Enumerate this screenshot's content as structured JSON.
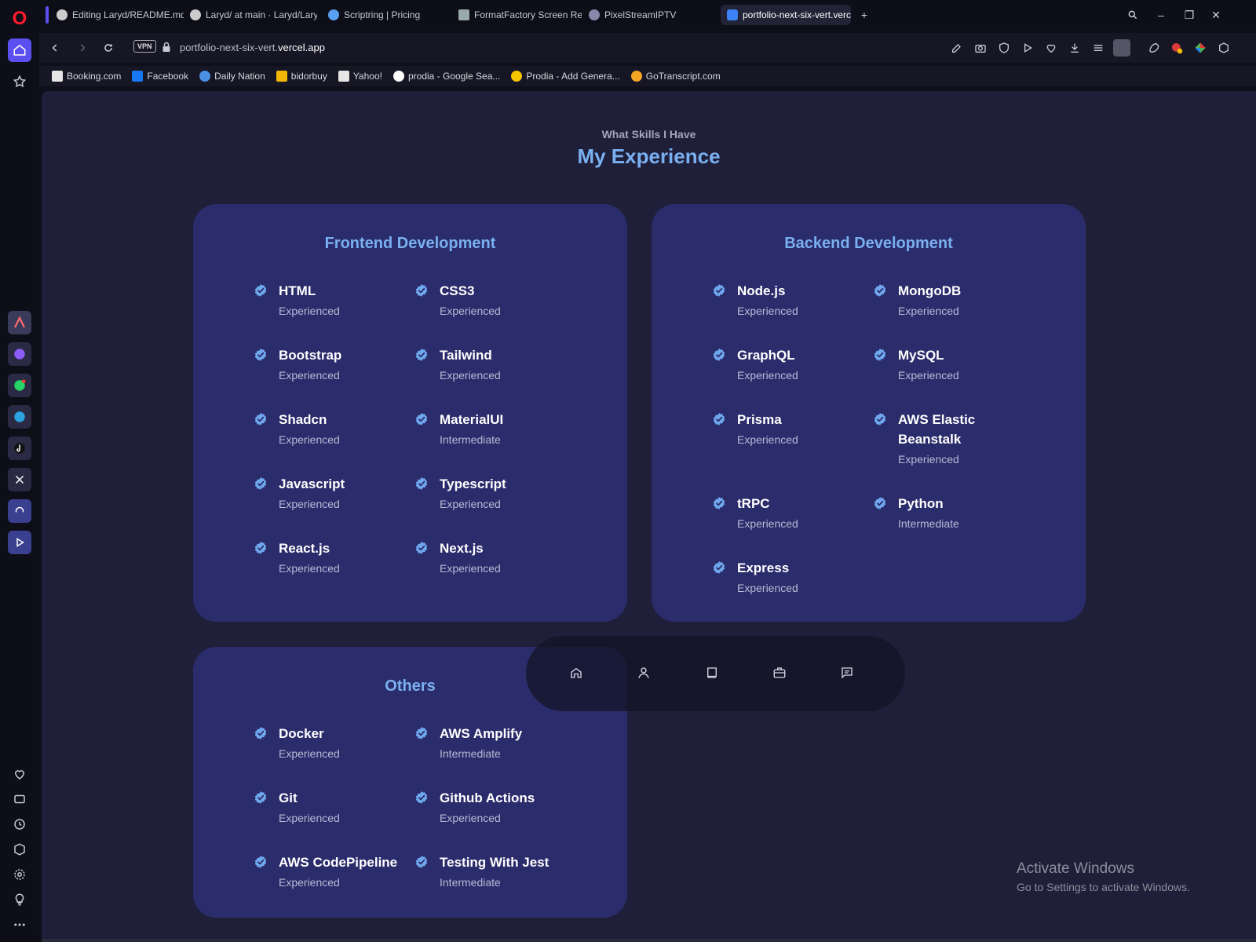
{
  "browser": {
    "tabs": [
      {
        "label": "Editing Laryd/README.md",
        "icon": "github-icon"
      },
      {
        "label": "Laryd/ at main · Laryd/Laryd",
        "icon": "github-icon"
      },
      {
        "label": "Scriptring | Pricing",
        "icon": "scriptring-icon"
      },
      {
        "label": "FormatFactory Screen Rec",
        "icon": "formatfactory-icon"
      },
      {
        "label": "PixelStreamIPTV",
        "icon": "pixelstream-icon"
      },
      {
        "label": "portfolio-next-six-vert.vercel.app",
        "icon": "portfolio-icon"
      }
    ],
    "url_prefix": "portfolio-next-six-vert.",
    "url_domain": "vercel.app",
    "vpn_label": "VPN",
    "bookmarks": [
      {
        "label": "Booking.com",
        "color": "#e6e6e6"
      },
      {
        "label": "Facebook",
        "color": "#1877f2"
      },
      {
        "label": "Daily Nation",
        "color": "#4a90e2"
      },
      {
        "label": "bidorbuy",
        "color": "#f2b705"
      },
      {
        "label": "Yahoo!",
        "color": "#e6e6e6"
      },
      {
        "label": "prodia - Google Sea...",
        "color": "#ffffff"
      },
      {
        "label": "Prodia - Add Genera...",
        "color": "#f5c400"
      },
      {
        "label": "GoTranscript.com",
        "color": "#f5a623"
      }
    ]
  },
  "page": {
    "subtitle": "What Skills I Have",
    "title": "My Experience",
    "frontend": {
      "title": "Frontend Development",
      "skills": [
        {
          "name": "HTML",
          "level": "Experienced"
        },
        {
          "name": "CSS3",
          "level": "Experienced"
        },
        {
          "name": "Bootstrap",
          "level": "Experienced"
        },
        {
          "name": "Tailwind",
          "level": "Experienced"
        },
        {
          "name": "Shadcn",
          "level": "Experienced"
        },
        {
          "name": "MaterialUI",
          "level": "Intermediate"
        },
        {
          "name": "Javascript",
          "level": "Experienced"
        },
        {
          "name": "Typescript",
          "level": "Experienced"
        },
        {
          "name": "React.js",
          "level": "Experienced"
        },
        {
          "name": "Next.js",
          "level": "Experienced"
        }
      ]
    },
    "backend": {
      "title": "Backend Development",
      "skills": [
        {
          "name": "Node.js",
          "level": "Experienced"
        },
        {
          "name": "MongoDB",
          "level": "Experienced"
        },
        {
          "name": "GraphQL",
          "level": "Experienced"
        },
        {
          "name": "MySQL",
          "level": "Experienced"
        },
        {
          "name": "Prisma",
          "level": "Experienced"
        },
        {
          "name": "AWS Elastic Beanstalk",
          "level": "Experienced"
        },
        {
          "name": "tRPC",
          "level": "Experienced"
        },
        {
          "name": "Python",
          "level": "Intermediate"
        },
        {
          "name": "Express",
          "level": "Experienced"
        }
      ]
    },
    "others": {
      "title": "Others",
      "skills": [
        {
          "name": "Docker",
          "level": "Experienced"
        },
        {
          "name": "AWS Amplify",
          "level": "Intermediate"
        },
        {
          "name": "Git",
          "level": "Experienced"
        },
        {
          "name": "Github Actions",
          "level": "Experienced"
        },
        {
          "name": "AWS CodePipeline",
          "level": "Experienced"
        },
        {
          "name": "Testing With Jest",
          "level": "Intermediate"
        }
      ]
    },
    "floating_nav": [
      "home-icon",
      "user-icon",
      "book-icon",
      "briefcase-icon",
      "message-icon"
    ]
  },
  "watermark": {
    "line1": "Activate Windows",
    "line2": "Go to Settings to activate Windows."
  },
  "colors": {
    "accent": "#7ab0f0",
    "card": "#2b2c6b",
    "page_bg": "#1f1f3a",
    "check": "#6fa8ee"
  }
}
